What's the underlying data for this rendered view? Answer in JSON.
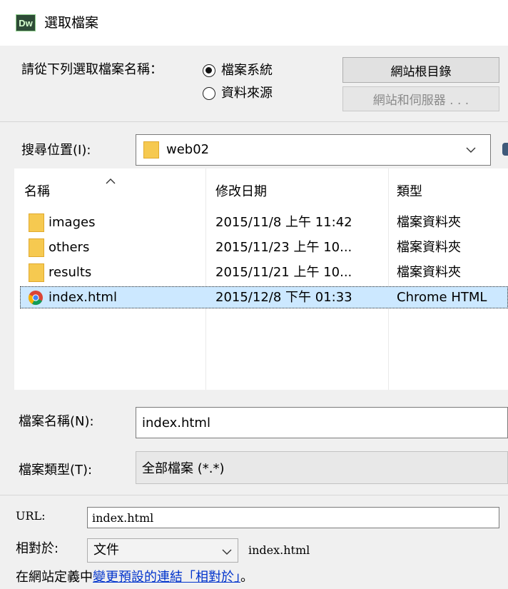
{
  "window": {
    "app_badge": "Dw",
    "title": "選取檔案"
  },
  "source": {
    "label": "請從下列選取檔案名稱：",
    "options": [
      "檔案系統",
      "資料來源"
    ],
    "selected_index": 0,
    "site_root_button": "網站根目錄",
    "servers_button": "網站和伺服器 . . ."
  },
  "look_in": {
    "label": "搜尋位置(I):",
    "value": "web02"
  },
  "list": {
    "columns": [
      "名稱",
      "修改日期",
      "類型"
    ],
    "rows": [
      {
        "name": "images",
        "date": "2015/11/8 上午 11:42",
        "type": "檔案資料夾",
        "icon": "folder-icon"
      },
      {
        "name": "others",
        "date": "2015/11/23 上午 10...",
        "type": "檔案資料夾",
        "icon": "folder-icon"
      },
      {
        "name": "results",
        "date": "2015/11/21 上午 10...",
        "type": "檔案資料夾",
        "icon": "folder-icon"
      },
      {
        "name": "index.html",
        "date": "2015/12/8 下午 01:33",
        "type": "Chrome HTML",
        "icon": "chrome-icon"
      }
    ],
    "selected_row": 3
  },
  "file_name": {
    "label": "檔案名稱(N):",
    "value": "index.html"
  },
  "file_type": {
    "label": "檔案類型(T):",
    "value": "全部檔案 (*.*)"
  },
  "url": {
    "label": "URL:",
    "value": "index.html"
  },
  "relative": {
    "label": "相對於:",
    "value": "文件",
    "path": "index.html"
  },
  "footer": {
    "prefix": "在網站定義中",
    "link": "變更預設的連結「相對於」",
    "suffix": "。"
  }
}
